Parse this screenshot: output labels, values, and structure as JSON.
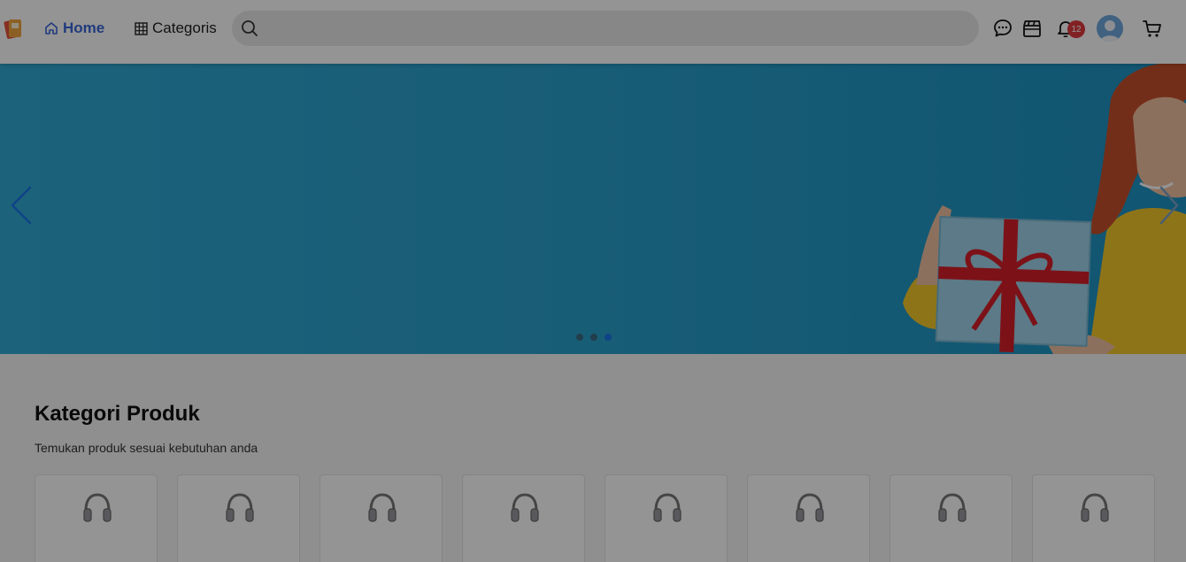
{
  "header": {
    "home_label": "Home",
    "categories_label": "Categoris",
    "search_placeholder": "",
    "notification_count": "12",
    "icons": [
      "logo-icon",
      "home-icon",
      "grid-icon",
      "search-icon",
      "chat-icon",
      "clapperboard-icon",
      "bell-icon",
      "avatar",
      "cart-icon"
    ]
  },
  "banner": {
    "active_slide": 3,
    "slide_count": 3,
    "background_color": "#2aa0cc"
  },
  "categories": {
    "title": "Kategori Produk",
    "subtitle": "Temukan produk sesuai kebutuhan anda",
    "card_icon": "headphones-icon",
    "items": [
      {
        "icon": "headphones-icon"
      },
      {
        "icon": "headphones-icon"
      },
      {
        "icon": "headphones-icon"
      },
      {
        "icon": "headphones-icon"
      },
      {
        "icon": "headphones-icon"
      },
      {
        "icon": "headphones-icon"
      },
      {
        "icon": "headphones-icon"
      },
      {
        "icon": "headphones-icon"
      }
    ]
  },
  "colors": {
    "accent": "#3a66d6",
    "badge": "#e0393e",
    "overlay": "rgba(0,0,0,0.42)"
  }
}
